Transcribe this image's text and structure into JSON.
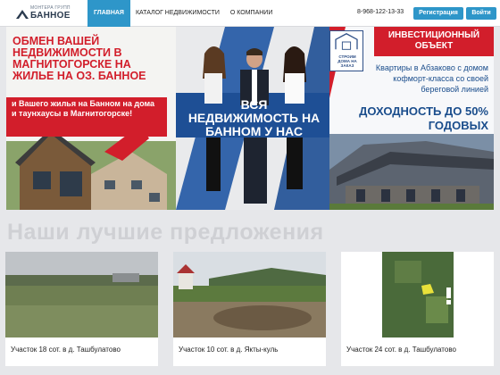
{
  "header": {
    "logo_line1": "МОНТЕРА ГРУПП",
    "logo_line2": "БАННОЕ",
    "nav": [
      "ГЛАВНАЯ",
      "КАТАЛОГ НЕДВИЖИМОСТИ",
      "О КОМПАНИИ"
    ],
    "phone": "8-968-122-13-33",
    "register_label": "Регистрация",
    "login_label": "Войти"
  },
  "banner": {
    "left_title": "ОБМЕН ВАШЕЙ НЕДВИЖИМОСТИ В МАГНИТОГОРСКЕ НА ЖИЛЬЕ НА ОЗ. БАННОЕ",
    "left_sub": "и Вашего жилья на Банном на дома и таунхаусы в Магнитогорске!",
    "center_title": "ВСЯ НЕДВИЖИМОСТЬ НА БАННОМ У НАС",
    "sign_text": "СТРОИМ ДОМА НА ЗАКАЗ",
    "invest_title": "ИНВЕСТИЦИОННЫЙ ОБЪЕКТ",
    "flats_text": "Квартиры в Абзаково с домом кофморт-класса со своей береговой линией",
    "yield_text": "ДОХОДНОСТЬ до 50% годовых"
  },
  "section_title": "Наши лучшие предложения",
  "cards": [
    {
      "caption": "Участок 18 сот. в д. Ташбулатово"
    },
    {
      "caption": "Участок 10 сот. в д. Якты-куль"
    },
    {
      "caption": "Участок 24 сот. в д. Ташбулатово"
    }
  ],
  "colors": {
    "accent": "#2e96c9",
    "brand_red": "#d21e2b",
    "navy": "#1a4d8c"
  }
}
